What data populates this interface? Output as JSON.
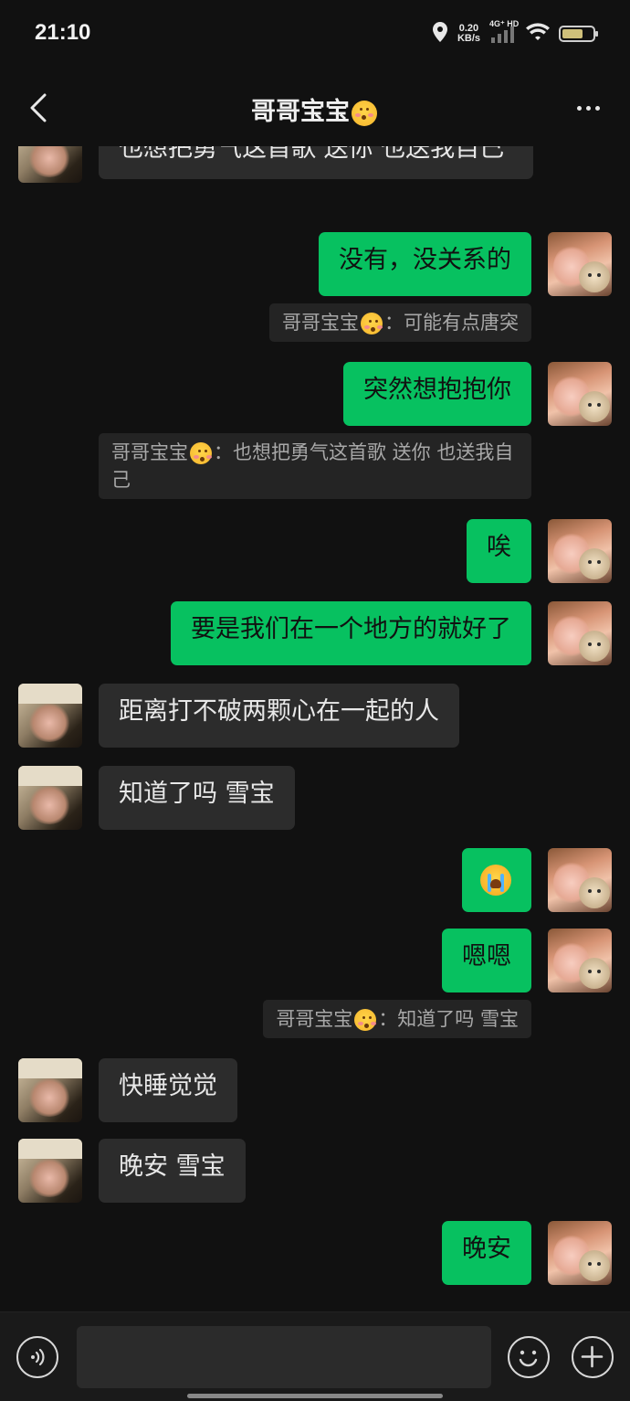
{
  "status_bar": {
    "time": "21:10",
    "net_speed_value": "0.20",
    "net_speed_unit": "KB/s",
    "net_type": "4G⁺ HD",
    "icons": [
      "location-icon",
      "signal-icon",
      "wifi-icon",
      "battery-icon"
    ]
  },
  "header": {
    "title": "哥哥宝宝",
    "title_emoji": "smiling-face-with-hearts",
    "back_icon": "chevron-left-icon",
    "more_icon": "more-dots-icon"
  },
  "messages": [
    {
      "from": "them",
      "text": "也想把勇气这首歌 送你 也送我自己"
    },
    {
      "from": "me",
      "text": "没有，没关系的"
    },
    {
      "from": "quote",
      "sender": "哥哥宝宝",
      "text": "：可能有点唐突"
    },
    {
      "from": "me",
      "text": "突然想抱抱你"
    },
    {
      "from": "quote",
      "sender": "哥哥宝宝",
      "text": "：也想把勇气这首歌 送你 也送我自己"
    },
    {
      "from": "me",
      "text": "唉"
    },
    {
      "from": "me",
      "text": "要是我们在一个地方的就好了"
    },
    {
      "from": "them",
      "text": "距离打不破两颗心在一起的人"
    },
    {
      "from": "them",
      "text": "知道了吗 雪宝"
    },
    {
      "from": "me",
      "emoji": "loudly-crying-face"
    },
    {
      "from": "me",
      "text": "嗯嗯"
    },
    {
      "from": "quote",
      "sender": "哥哥宝宝",
      "text": "：知道了吗 雪宝"
    },
    {
      "from": "them",
      "text": "快睡觉觉"
    },
    {
      "from": "them",
      "text": "晚安 雪宝"
    },
    {
      "from": "me",
      "text": "晚安"
    }
  ],
  "input_bar": {
    "placeholder": "",
    "voice_icon": "voice-icon",
    "emoji_icon": "emoji-icon",
    "plus_icon": "plus-icon"
  },
  "colors": {
    "background": "#111111",
    "my_bubble": "#07c160",
    "their_bubble": "#2c2c2c",
    "quote_bg": "#242424"
  }
}
